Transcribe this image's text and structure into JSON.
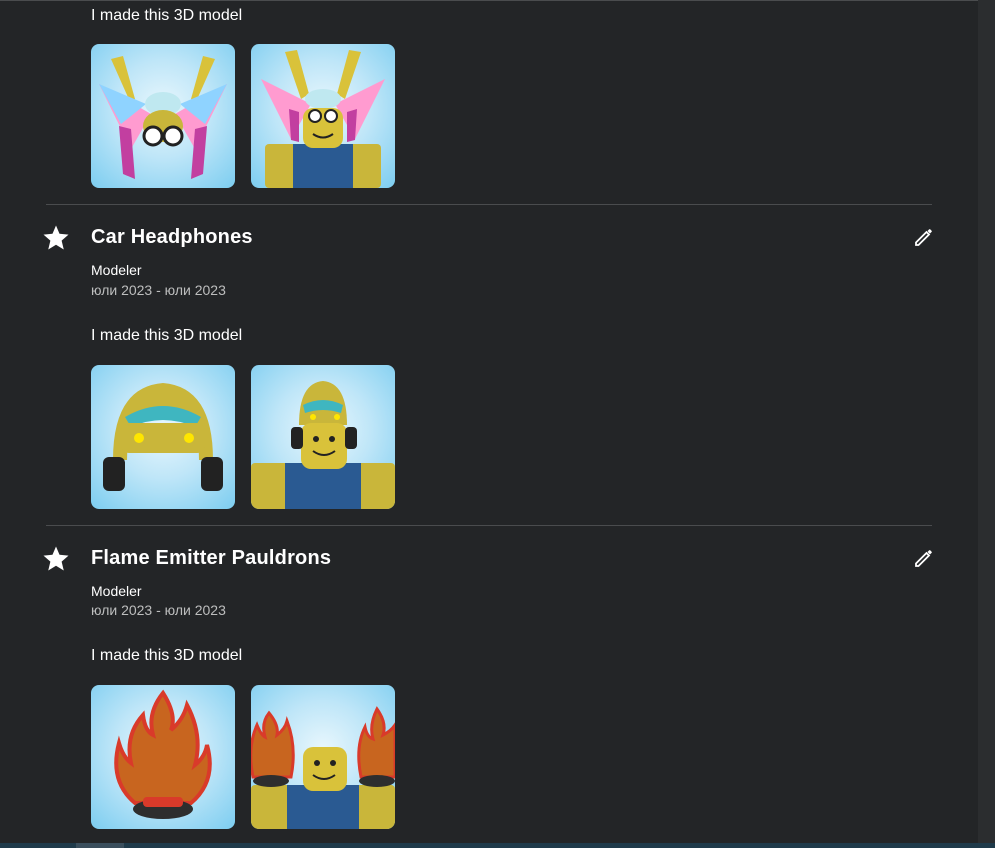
{
  "entries": [
    {
      "title": "",
      "role": "",
      "dates": "",
      "description": "I made this 3D model",
      "images": [
        {
          "icon": "winged-hat-item-preview"
        },
        {
          "icon": "winged-hat-avatar-preview"
        }
      ]
    },
    {
      "title": "Car Headphones",
      "role": "Modeler",
      "dates": "юли 2023 - юли 2023",
      "description": "I made this 3D model",
      "images": [
        {
          "icon": "car-headphones-item-preview"
        },
        {
          "icon": "car-headphones-avatar-preview"
        }
      ]
    },
    {
      "title": "Flame Emitter Pauldrons",
      "role": "Modeler",
      "dates": "юли 2023 - юли 2023",
      "description": "I made this 3D model",
      "images": [
        {
          "icon": "flame-pauldron-item-preview"
        },
        {
          "icon": "flame-pauldron-avatar-preview"
        }
      ]
    }
  ],
  "icons": {
    "star": "star-icon",
    "edit": "pencil-icon"
  },
  "colors": {
    "background": "#232527",
    "text": "#ffffff",
    "muted_text": "#bdbebe",
    "divider": "#4a4c4e",
    "thumb_sky": "#7ccdf0"
  }
}
